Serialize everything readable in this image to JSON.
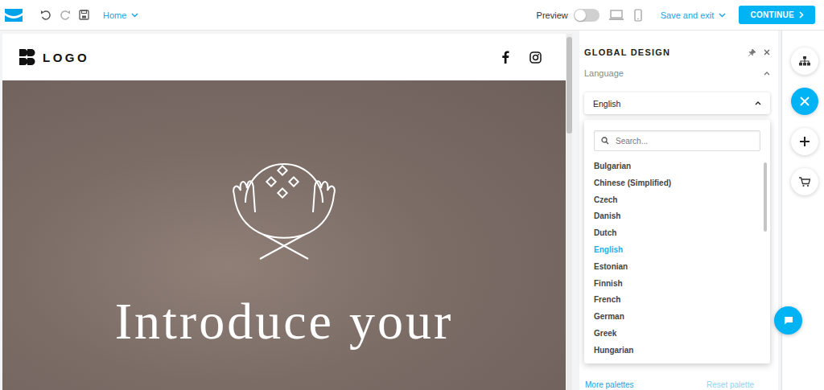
{
  "toolbar": {
    "page_menu": "Home",
    "preview": {
      "label": "Preview",
      "on": false
    },
    "save_menu": "Save and exit",
    "continue_button": "CONTINUE"
  },
  "site": {
    "logo": "LOGO",
    "hero_heading": "Introduce your"
  },
  "panel": {
    "title": "GLOBAL DESIGN",
    "section": {
      "label": "Language",
      "expanded": true
    },
    "dropdown": {
      "value": "English",
      "open": true
    },
    "search": {
      "placeholder": "Search..."
    },
    "options": [
      {
        "label": "Bulgarian",
        "selected": false
      },
      {
        "label": "Chinese (Simplified)",
        "selected": false
      },
      {
        "label": "Czech",
        "selected": false
      },
      {
        "label": "Danish",
        "selected": false
      },
      {
        "label": "Dutch",
        "selected": false
      },
      {
        "label": "English",
        "selected": true
      },
      {
        "label": "Estonian",
        "selected": false
      },
      {
        "label": "Finnish",
        "selected": false
      },
      {
        "label": "French",
        "selected": false
      },
      {
        "label": "German",
        "selected": false
      },
      {
        "label": "Greek",
        "selected": false
      },
      {
        "label": "Hungarian",
        "selected": false
      }
    ],
    "footer": {
      "more": {
        "label": "More palettes",
        "disabled": false
      },
      "reset": {
        "label": "Reset palette",
        "disabled": true
      }
    }
  },
  "tools": [
    {
      "kind": "sitemap",
      "selected": false
    },
    {
      "kind": "close",
      "selected": true
    },
    {
      "kind": "add",
      "selected": false
    },
    {
      "kind": "cart",
      "selected": false
    }
  ]
}
